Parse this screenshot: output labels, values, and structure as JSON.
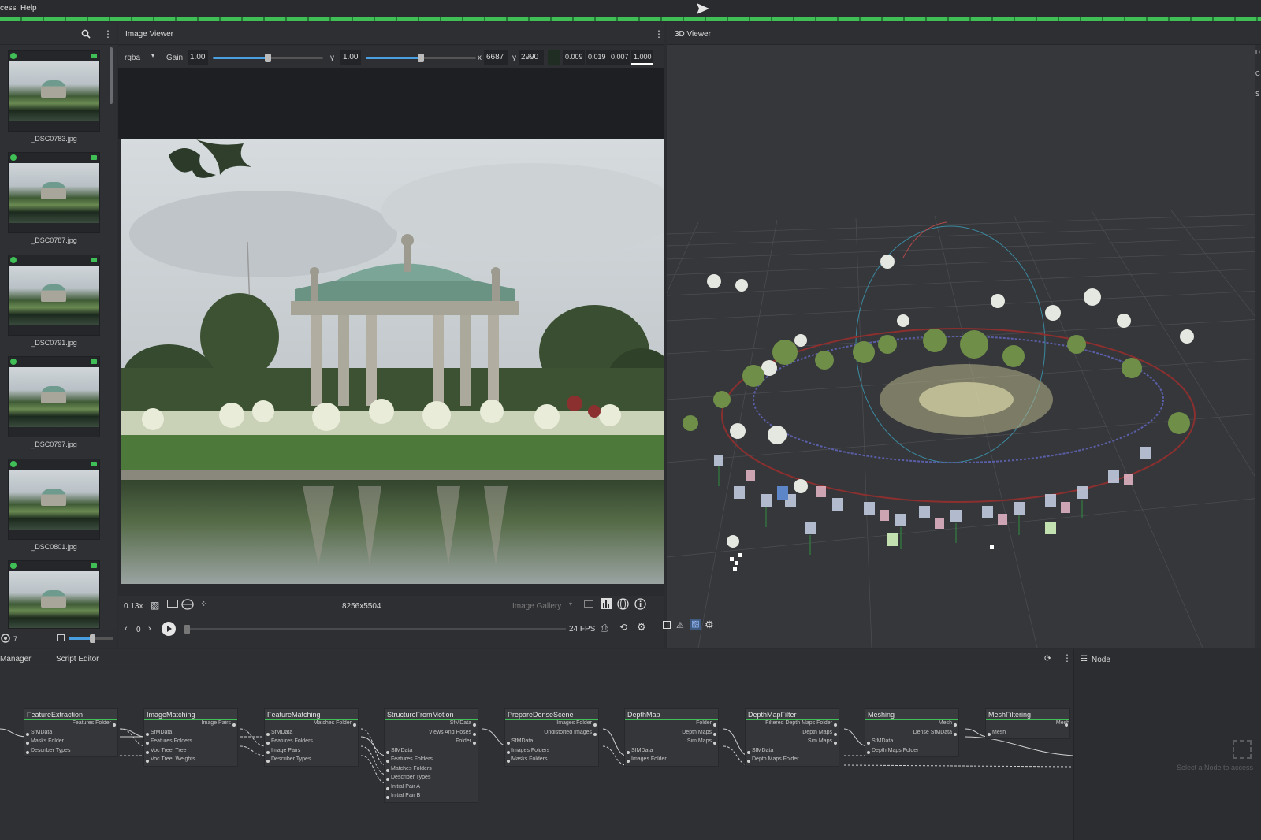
{
  "menu": {
    "items": [
      "cess",
      "Help"
    ]
  },
  "gallery": {
    "count": "7",
    "thumbs": [
      {
        "label": "_DSC0783.jpg"
      },
      {
        "label": "_DSC0787.jpg"
      },
      {
        "label": "_DSC0791.jpg"
      },
      {
        "label": "_DSC0797.jpg"
      },
      {
        "label": "_DSC0801.jpg"
      },
      {
        "label": ""
      }
    ]
  },
  "image_viewer": {
    "title": "Image Viewer",
    "channel": "rgba",
    "gain_label": "Gain",
    "gain_value": "1.00",
    "gamma_label": "γ",
    "gamma_value": "1.00",
    "x_label": "x",
    "x_value": "6687",
    "y_label": "y",
    "y_value": "2990",
    "pixel_values": [
      "0.009",
      "0.019",
      "0.007",
      "1.000"
    ],
    "zoom": "0.13x",
    "resolution": "8256x5504",
    "gallery_select": "Image Gallery",
    "frame": "0",
    "fps": "24 FPS"
  },
  "viewer3d": {
    "title": "3D Viewer",
    "side_letters": [
      "D",
      "C",
      "S"
    ]
  },
  "graph_tabs": {
    "manager": "Manager",
    "script": "Script Editor",
    "node_tab": "Node",
    "node_hint": "Select a Node to access"
  },
  "nodes": [
    {
      "title": "FeatureExtraction",
      "outputs": [
        "Features Folder"
      ],
      "inputs": [
        "SfMData",
        "Masks Folder",
        "Describer Types"
      ]
    },
    {
      "title": "ImageMatching",
      "outputs": [
        "Image Pairs"
      ],
      "inputs": [
        "SfMData",
        "Features Folders",
        "Voc Tree: Tree",
        "Voc Tree: Weights"
      ]
    },
    {
      "title": "FeatureMatching",
      "outputs": [
        "Matches Folder"
      ],
      "inputs": [
        "SfMData",
        "Features Folders",
        "Image Pairs",
        "Describer Types"
      ]
    },
    {
      "title": "StructureFromMotion",
      "outputs": [
        "SfMData",
        "Views And Poses",
        "Folder"
      ],
      "inputs": [
        "SfMData",
        "Features Folders",
        "Matches Folders",
        "Describer Types",
        "Initial Pair A",
        "Initial Pair B"
      ]
    },
    {
      "title": "PrepareDenseScene",
      "outputs": [
        "Images Folder",
        "Undistorted Images"
      ],
      "inputs": [
        "SfMData",
        "Images Folders",
        "Masks Folders"
      ]
    },
    {
      "title": "DepthMap",
      "outputs": [
        "Folder",
        "Depth Maps",
        "Sim Maps"
      ],
      "inputs": [
        "SfMData",
        "Images Folder"
      ]
    },
    {
      "title": "DepthMapFilter",
      "outputs": [
        "Filtered Depth Maps Folder",
        "Depth Maps",
        "Sim Maps"
      ],
      "inputs": [
        "SfMData",
        "Depth Maps Folder"
      ]
    },
    {
      "title": "Meshing",
      "outputs": [
        "Mesh",
        "Dense SfMData"
      ],
      "inputs": [
        "SfMData",
        "Depth Maps Folder"
      ]
    },
    {
      "title": "MeshFiltering",
      "outputs": [
        "Mesh"
      ],
      "inputs": [
        "Mesh"
      ]
    }
  ],
  "colors": {
    "accent": "#3fbf55",
    "panel": "#333438",
    "slider": "#4a9fe0"
  }
}
